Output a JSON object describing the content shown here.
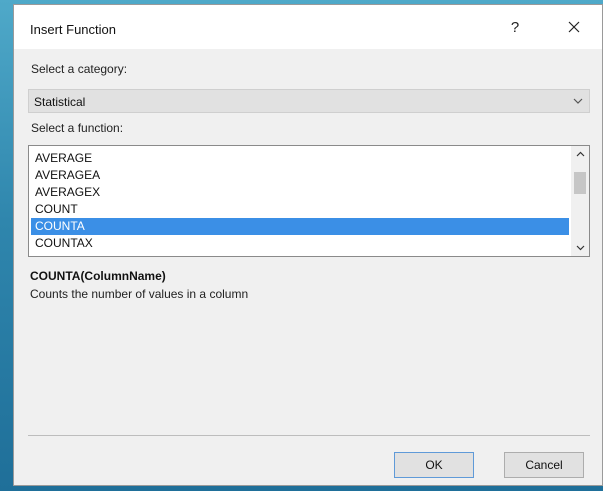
{
  "dialog": {
    "title": "Insert Function",
    "help_label": "?"
  },
  "category": {
    "label": "Select a category:",
    "selected": "Statistical"
  },
  "functions": {
    "label": "Select a function:",
    "items": [
      "AVERAGE",
      "AVERAGEA",
      "AVERAGEX",
      "COUNT",
      "COUNTA",
      "COUNTAX"
    ],
    "selected_index": 4
  },
  "details": {
    "syntax": "COUNTA(ColumnName)",
    "description": "Counts the number of values in a column"
  },
  "buttons": {
    "ok": "OK",
    "cancel": "Cancel"
  },
  "colors": {
    "selection": "#3b8fe6",
    "dialog_bg": "#f0f0f0"
  },
  "icons": {
    "close": "close-icon",
    "dropdown": "chevron-down-icon",
    "scroll_up": "chevron-up-icon",
    "scroll_down": "chevron-down-icon"
  }
}
